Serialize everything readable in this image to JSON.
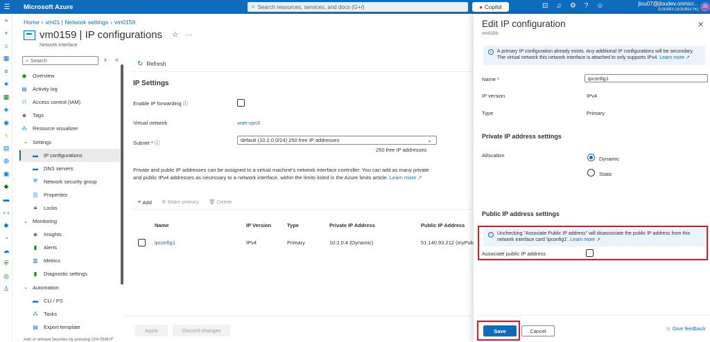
{
  "topbar": {
    "brand": "Microsoft Azure",
    "search_placeholder": "Search resources, services, and docs (G+/)",
    "copilot": "Copilot",
    "user_line1": "jlou07@jloudev.onmicr...",
    "user_line2": "JLOUDEV (JLOUDEV.TK)",
    "avatar": "JD"
  },
  "breadcrumb": [
    "Home",
    "vm01 | Network settings",
    "vm0159"
  ],
  "page": {
    "title": "vm0159 | IP configurations",
    "subtitle": "Network interface",
    "search_placeholder": "Search"
  },
  "nav": [
    {
      "label": "Overview",
      "icon": "overview-icon",
      "kind": "item"
    },
    {
      "label": "Activity log",
      "icon": "activity-log-icon",
      "kind": "item"
    },
    {
      "label": "Access control (IAM)",
      "icon": "iam-icon",
      "kind": "item"
    },
    {
      "label": "Tags",
      "icon": "tag-icon",
      "kind": "item"
    },
    {
      "label": "Resource visualizer",
      "icon": "visualizer-icon",
      "kind": "item"
    },
    {
      "label": "Settings",
      "kind": "group"
    },
    {
      "label": "IP configurations",
      "icon": "ip-config-icon",
      "kind": "sub",
      "active": true
    },
    {
      "label": "DNS servers",
      "icon": "dns-icon",
      "kind": "sub"
    },
    {
      "label": "Network security group",
      "icon": "shield-icon",
      "kind": "sub"
    },
    {
      "label": "Properties",
      "icon": "properties-icon",
      "kind": "sub"
    },
    {
      "label": "Locks",
      "icon": "lock-icon",
      "kind": "sub"
    },
    {
      "label": "Monitoring",
      "kind": "group"
    },
    {
      "label": "Insights",
      "icon": "insights-icon",
      "kind": "sub"
    },
    {
      "label": "Alerts",
      "icon": "alerts-icon",
      "kind": "sub"
    },
    {
      "label": "Metrics",
      "icon": "metrics-icon",
      "kind": "sub"
    },
    {
      "label": "Diagnostic settings",
      "icon": "diagnostic-icon",
      "kind": "sub"
    },
    {
      "label": "Automation",
      "kind": "group"
    },
    {
      "label": "CLI / PS",
      "icon": "cli-icon",
      "kind": "sub"
    },
    {
      "label": "Tasks",
      "icon": "tasks-icon",
      "kind": "sub"
    },
    {
      "label": "Export template",
      "icon": "export-icon",
      "kind": "sub"
    }
  ],
  "footer_note": "Add or remove favorites by pressing Ctrl+Shift+F",
  "main": {
    "refresh": "Refresh",
    "section_title": "IP Settings",
    "enable_ip_forwarding": "Enable IP forwarding",
    "virtual_network_label": "Virtual network",
    "virtual_network_value": "vnet-vpn3",
    "subnet_label": "Subnet *",
    "subnet_value": "default (10.2.0.0/24) 250 free IP addresses",
    "free_ips": "250 free IP addresses",
    "paragraph": "Private and public IP addresses can be assigned to a virtual machine's network interface controller. You can add as many private and public IPv4 addresses as necessary to a network interface, within the limits listed in the Azure limits article.",
    "learn_more": "Learn more",
    "toolbar": {
      "add": "Add",
      "make_primary": "Make primary",
      "delete": "Delete"
    },
    "table": {
      "headers": [
        "Name",
        "IP Version",
        "Type",
        "Private IP Address",
        "Public IP Address"
      ],
      "rows": [
        [
          "ipconfig1",
          "IPv4",
          "Primary",
          "10.2.0.4 (Dynamic)",
          "51.140.93.212 (myPubl"
        ]
      ]
    },
    "apply": "Apply",
    "discard": "Discard changes"
  },
  "panel": {
    "title": "Edit IP configuration",
    "subtitle": "vm0159",
    "info1": "A primary IP configuration already exists. Any additional IP configurations will be secondary. The virtual network this network interface is attached to only supports IPv4.",
    "info1_link": "Learn more",
    "name_label": "Name *",
    "name_value": "ipconfig1",
    "ipversion_label": "IP version",
    "ipversion_value": "IPv4",
    "type_label": "Type",
    "type_value": "Primary",
    "private_heading": "Private IP address settings",
    "allocation_label": "Allocation",
    "dynamic": "Dynamic",
    "static": "Static",
    "public_heading": "Public IP address settings",
    "info2": "Unchecking \"Associate Public IP address\" will disassociate the public IP address from this network interface card 'ipconfig1'.",
    "info2_link": "Learn more",
    "associate_label": "Associate public IP address",
    "save": "Save",
    "cancel": "Cancel",
    "feedback": "Give feedback"
  }
}
